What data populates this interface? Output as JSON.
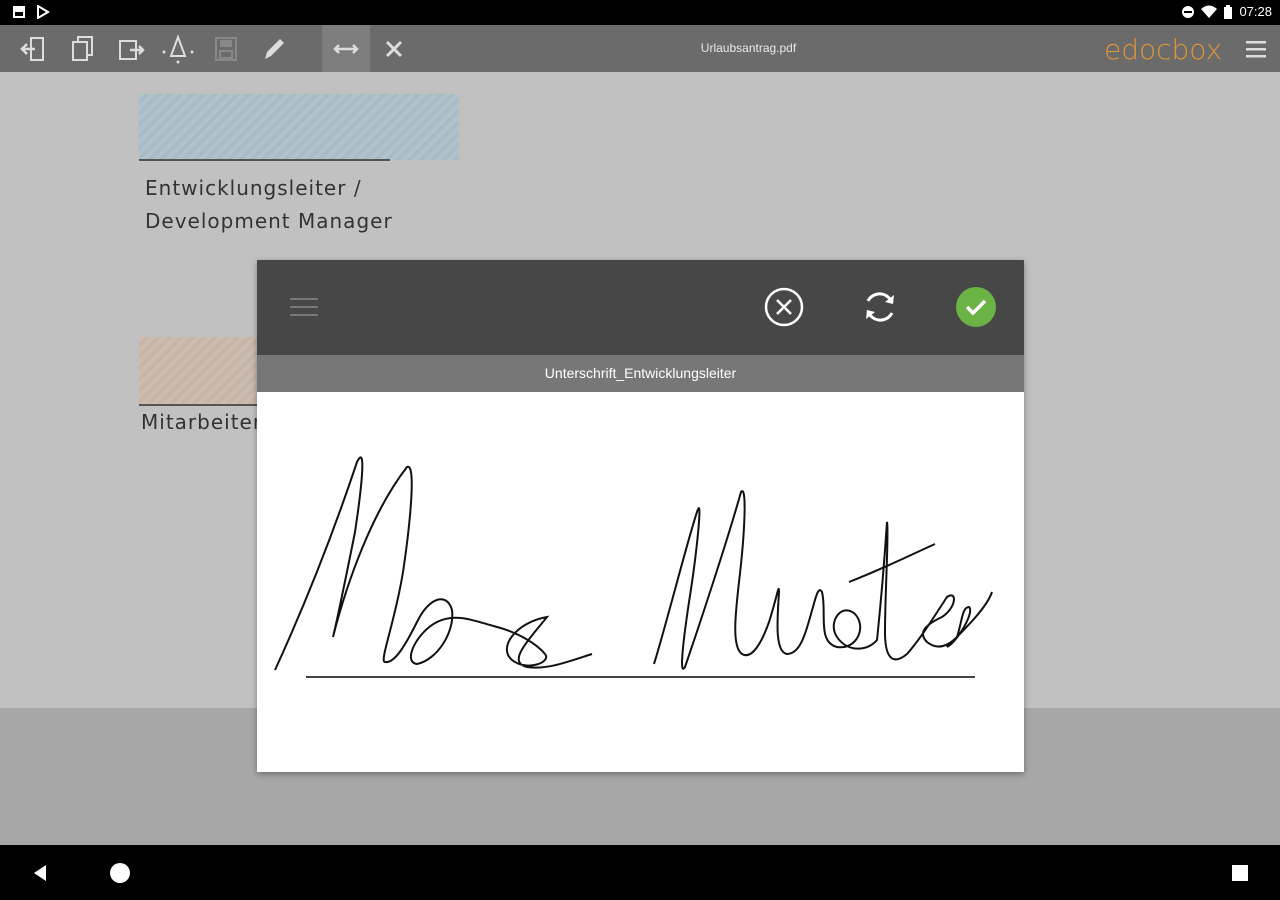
{
  "status_bar": {
    "time": "07:28",
    "icons": [
      "gallery-icon",
      "play-store-icon",
      "dnd-icon",
      "wifi-icon",
      "battery-icon"
    ]
  },
  "toolbar": {
    "document_title": "Urlaubsantrag.pdf",
    "logo": "edocbox",
    "buttons": [
      "exit-icon",
      "copy-icon",
      "export-icon",
      "pen-marker-icon",
      "save-icon",
      "edit-pencil-icon",
      "fit-width-icon",
      "close-icon"
    ],
    "menu_icon": "hamburger-icon"
  },
  "document": {
    "field1_label_line1": "Entwicklungsleiter /",
    "field1_label_line2": "Development Manager",
    "field2_label": "Mitarbeiter"
  },
  "dialog": {
    "title": "Unterschrift_Entwicklungsleiter",
    "cancel_icon": "cancel-circle-icon",
    "reset_icon": "refresh-icon",
    "confirm_icon": "check-circle-icon",
    "menu_icon": "hamburger-icon",
    "signature_text": "Max Muster"
  },
  "colors": {
    "toolbar": "#6b6b6b",
    "logo": "#e0963a",
    "confirm": "#6ab344",
    "dialog_header": "#474747"
  },
  "nav_bar": {
    "buttons": [
      "back-icon",
      "home-icon",
      "recents-icon"
    ]
  }
}
